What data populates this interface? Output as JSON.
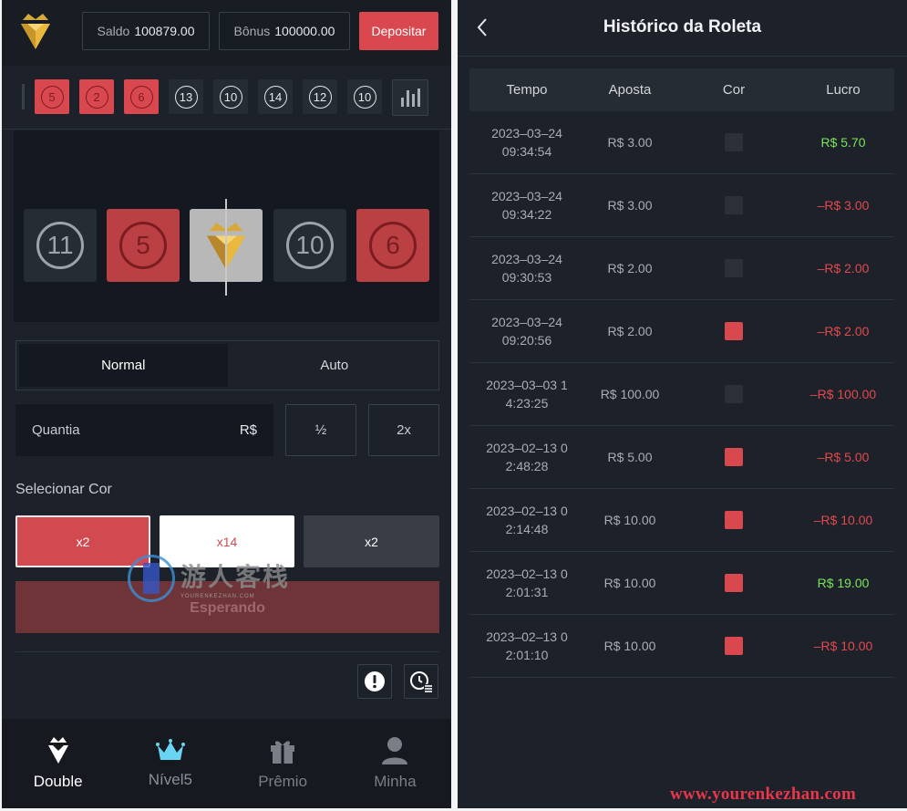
{
  "topbar": {
    "saldo_label": "Saldo",
    "saldo_value": "100879.00",
    "bonus_label": "Bônus",
    "bonus_value": "100000.00",
    "deposit_label": "Depositar"
  },
  "history_strip": [
    {
      "n": "5",
      "color": "red"
    },
    {
      "n": "2",
      "color": "red"
    },
    {
      "n": "6",
      "color": "red"
    },
    {
      "n": "13",
      "color": "dark"
    },
    {
      "n": "10",
      "color": "dark"
    },
    {
      "n": "14",
      "color": "dark"
    },
    {
      "n": "12",
      "color": "dark"
    },
    {
      "n": "10",
      "color": "dark"
    }
  ],
  "wheel_tiles": [
    {
      "n": "11",
      "color": "dark"
    },
    {
      "n": "5",
      "color": "red"
    },
    {
      "n": "",
      "color": "white"
    },
    {
      "n": "10",
      "color": "dark"
    },
    {
      "n": "6",
      "color": "red"
    }
  ],
  "mode_tabs": {
    "normal": "Normal",
    "auto": "Auto"
  },
  "amount": {
    "placeholder": "Quantia",
    "currency": "R$",
    "half": "½",
    "double": "2x"
  },
  "select_color": {
    "label": "Selecionar Cor",
    "red": "x2",
    "white": "x14",
    "black": "x2"
  },
  "wait_label": "Esperando",
  "nav": [
    {
      "label": "Double",
      "icon": "diamond-crown-icon"
    },
    {
      "label": "Nível5",
      "icon": "crown-icon"
    },
    {
      "label": "Prêmio",
      "icon": "gift-icon"
    },
    {
      "label": "Minha",
      "icon": "user-icon"
    }
  ],
  "history": {
    "title": "Histórico da Roleta",
    "columns": [
      "Tempo",
      "Aposta",
      "Cor",
      "Lucro"
    ],
    "rows": [
      {
        "time": "2023–03–24\n09:34:54",
        "bet": "R$ 3.00",
        "color": "dark",
        "profit": "R$ 5.70",
        "gain": true
      },
      {
        "time": "2023–03–24\n09:34:22",
        "bet": "R$ 3.00",
        "color": "dark",
        "profit": "–R$ 3.00",
        "gain": false
      },
      {
        "time": "2023–03–24\n09:30:53",
        "bet": "R$ 2.00",
        "color": "dark",
        "profit": "–R$ 2.00",
        "gain": false
      },
      {
        "time": "2023–03–24\n09:20:56",
        "bet": "R$ 2.00",
        "color": "red",
        "profit": "–R$ 2.00",
        "gain": false
      },
      {
        "time": "2023–03–03 1\n4:23:25",
        "bet": "R$ 100.00",
        "color": "dark",
        "profit": "–R$ 100.00",
        "gain": false
      },
      {
        "time": "2023–02–13 0\n2:48:28",
        "bet": "R$ 5.00",
        "color": "red",
        "profit": "–R$ 5.00",
        "gain": false
      },
      {
        "time": "2023–02–13 0\n2:14:48",
        "bet": "R$ 10.00",
        "color": "red",
        "profit": "–R$ 10.00",
        "gain": false
      },
      {
        "time": "2023–02–13 0\n2:01:31",
        "bet": "R$ 10.00",
        "color": "red",
        "profit": "R$ 19.00",
        "gain": true
      },
      {
        "time": "2023–02–13 0\n2:01:10",
        "bet": "R$ 10.00",
        "color": "red",
        "profit": "–R$ 10.00",
        "gain": false
      }
    ]
  },
  "watermark": {
    "site": "www.yourenkezhan.com",
    "logo_text": "游人客栈",
    "logo_sub": "YOURENKEZHAN.COM"
  }
}
